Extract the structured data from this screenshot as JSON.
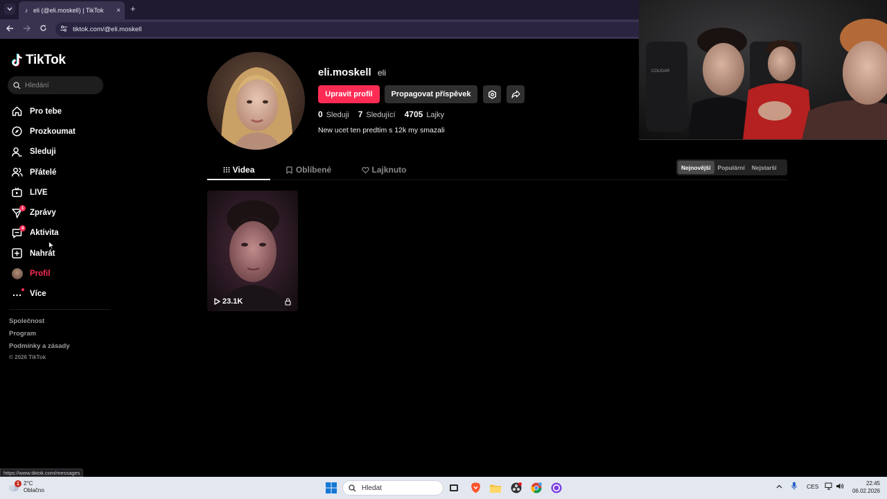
{
  "browser": {
    "tab_title": "eli (@eli.moskell) | TikTok",
    "tab_close": "×",
    "new_tab": "+",
    "url": "tiktok.com/@eli.moskell",
    "status_url": "https://www.tiktok.com/messages"
  },
  "sidebar": {
    "logo": "TikTok",
    "search_placeholder": "Hledání",
    "items": [
      {
        "label": "Pro tebe",
        "icon": "home-icon"
      },
      {
        "label": "Prozkoumat",
        "icon": "compass-icon"
      },
      {
        "label": "Sleduji",
        "icon": "following-icon"
      },
      {
        "label": "Přátelé",
        "icon": "friends-icon"
      },
      {
        "label": "LIVE",
        "icon": "live-icon"
      },
      {
        "label": "Zprávy",
        "icon": "messages-icon",
        "badge": "1"
      },
      {
        "label": "Aktivita",
        "icon": "activity-icon",
        "badge": "4"
      },
      {
        "label": "Nahrát",
        "icon": "upload-icon"
      },
      {
        "label": "Profil",
        "icon": "avatar",
        "active": true
      },
      {
        "label": "Více",
        "icon": "more-icon"
      }
    ],
    "footer": {
      "company": "Společnost",
      "program": "Program",
      "terms": "Podmínky a zásady",
      "copyright": "© 2026 TikTok"
    }
  },
  "profile": {
    "username": "eli.moskell",
    "nickname": "eli",
    "edit_button": "Upravit profil",
    "promote_button": "Propagovat příspěvek",
    "following_count": "0",
    "following_label": "Sleduji",
    "followers_count": "7",
    "followers_label": "Sledující",
    "likes_count": "4705",
    "likes_label": "Lajky",
    "bio": "New ucet ten predtim s 12k my smazali"
  },
  "tabs": [
    {
      "label": "Videa",
      "active": true
    },
    {
      "label": "Oblíbené"
    },
    {
      "label": "Lajknuto"
    }
  ],
  "sort": [
    {
      "label": "Nejnovější",
      "active": true
    },
    {
      "label": "Populární"
    },
    {
      "label": "Nejstarší"
    }
  ],
  "videos": [
    {
      "plays": "23.1K",
      "private": true
    }
  ],
  "taskbar": {
    "weather_temp": "2°C",
    "weather_desc": "Oblačno",
    "weather_badge": "1",
    "search_placeholder": "Hledat",
    "language": "CES",
    "time": "22:45",
    "date": "06.02.2026"
  },
  "colors": {
    "accent": "#fe2c55",
    "background": "#000000",
    "taskbar": "#e3e7ef"
  }
}
